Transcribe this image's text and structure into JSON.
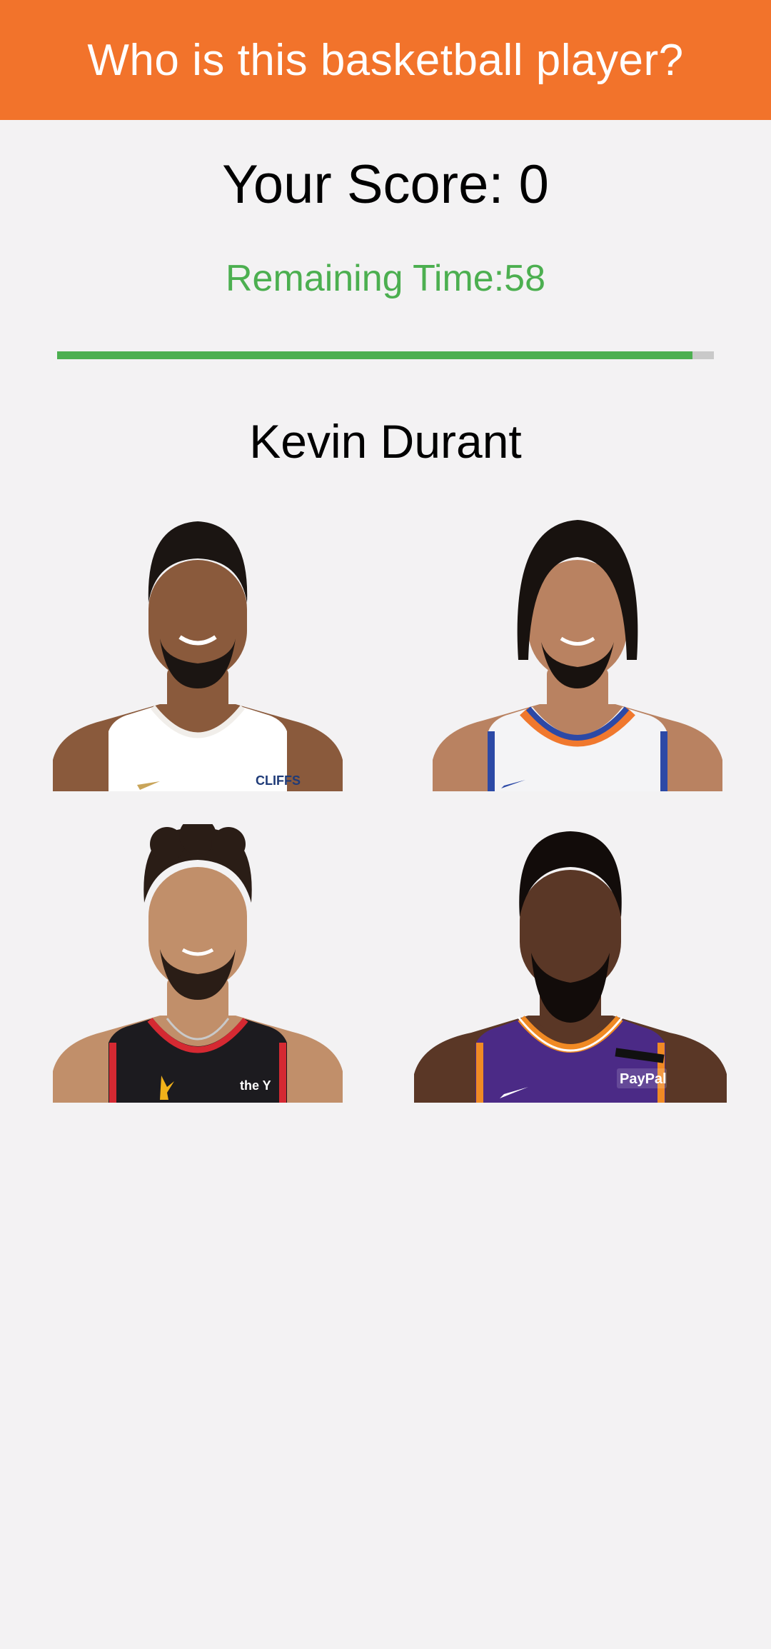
{
  "app_bar": {
    "title": "Who is this basketball player?"
  },
  "score_text": "Your Score: 0",
  "timer_text": "Remaining Time:58",
  "progress": {
    "fraction": 0.967
  },
  "question": {
    "player_name": "Kevin Durant"
  },
  "choices": [
    {
      "jersey_text": "CLIFFS",
      "colors": {
        "skin": "#8a5a3c",
        "jersey": "#ffffff",
        "trim": "#f1eeea",
        "accent": "#c9a55a",
        "hair": "#1b1512"
      }
    },
    {
      "jersey_text": "",
      "colors": {
        "skin": "#b98261",
        "jersey": "#f4f4f6",
        "trim": "#2c49a6",
        "accent": "#f0782e",
        "hair": "#18120f"
      }
    },
    {
      "jersey_text": "the Y",
      "colors": {
        "skin": "#c18f6a",
        "jersey": "#1c1b1f",
        "trim": "#d52932",
        "accent": "#f2b21a",
        "hair": "#2a1d16"
      }
    },
    {
      "jersey_text": "PayPal",
      "colors": {
        "skin": "#5a3726",
        "jersey": "#4b2a86",
        "trim": "#f08a24",
        "accent": "#ffffff",
        "hair": "#120c0a"
      }
    }
  ]
}
